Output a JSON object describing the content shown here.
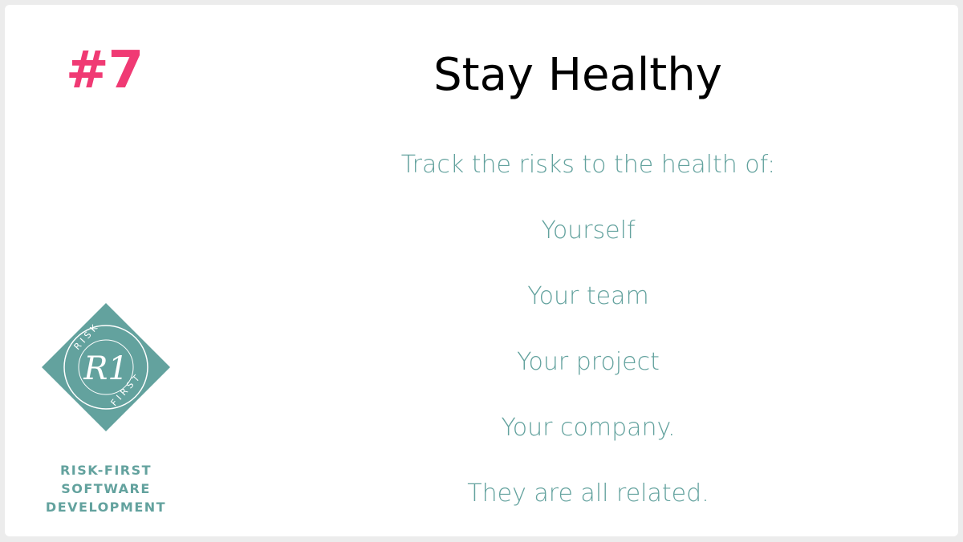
{
  "slide": {
    "number": "#7",
    "title": "Stay Healthy",
    "lines": [
      "Track the risks to the health of:",
      "Yourself",
      "Your team",
      "Your project",
      "Your company.",
      "They are all related."
    ]
  },
  "brand": {
    "logo_icon": "risk-first-diamond-logo",
    "logo_text_top": "RISK",
    "logo_text_bottom": "FIRST",
    "logo_monogram": "R1",
    "line1": "RISK-FIRST",
    "line2": "SOFTWARE",
    "line3": "DEVELOPMENT"
  },
  "colors": {
    "accent_pink": "#f03a74",
    "teal": "#63a29e",
    "title": "#000000",
    "background": "#ffffff"
  }
}
